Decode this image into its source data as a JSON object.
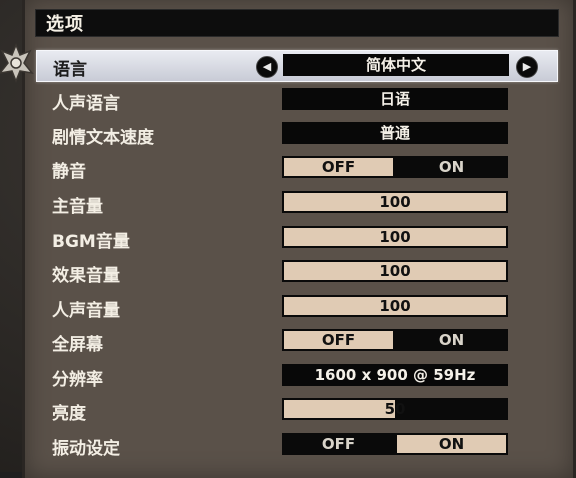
{
  "title": "选项",
  "colors": {
    "panel": "#5a5149",
    "highlight": "#e0cbb4",
    "selected_row": "#dfe1e9",
    "value_bg": "#080808"
  },
  "rows": [
    {
      "label": "语言",
      "type": "select",
      "value": "简体中文",
      "selected": true
    },
    {
      "label": "人声语言",
      "type": "select",
      "value": "日语"
    },
    {
      "label": "剧情文本速度",
      "type": "select",
      "value": "普通"
    },
    {
      "label": "静音",
      "type": "toggle",
      "off": "OFF",
      "on": "ON",
      "state": "OFF"
    },
    {
      "label": "主音量",
      "type": "slider",
      "value": "100",
      "fraction": 1.0
    },
    {
      "label": "BGM音量",
      "type": "slider",
      "value": "100",
      "fraction": 1.0
    },
    {
      "label": "效果音量",
      "type": "slider",
      "value": "100",
      "fraction": 1.0
    },
    {
      "label": "人声音量",
      "type": "slider",
      "value": "100",
      "fraction": 1.0
    },
    {
      "label": "全屏幕",
      "type": "toggle",
      "off": "OFF",
      "on": "ON",
      "state": "OFF"
    },
    {
      "label": "分辨率",
      "type": "select",
      "value": "1600 x 900 @ 59Hz"
    },
    {
      "label": "亮度",
      "type": "slider",
      "value": "50",
      "fraction": 0.5
    },
    {
      "label": "振动设定",
      "type": "toggle",
      "off": "OFF",
      "on": "ON",
      "state": "ON"
    }
  ],
  "icons": {
    "left_arrow": "left-arrow-icon",
    "right_arrow": "right-arrow-icon",
    "cursor_ornament": "ornament-cursor-icon"
  }
}
